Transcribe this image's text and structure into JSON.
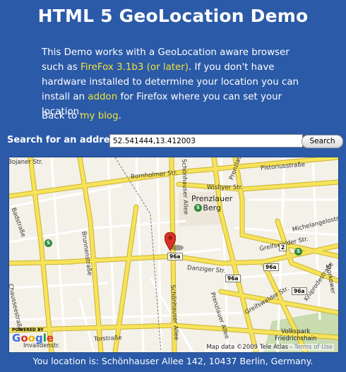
{
  "page": {
    "title": "HTML 5 GeoLocation Demo",
    "intro_part1": "This Demo works with a GeoLocation aware browser such as ",
    "intro_link1": "FireFox 3.1b3 (or later)",
    "intro_part2": ". If you don't have hardware installed to determine your location you can install an ",
    "intro_link2": "addon",
    "intro_part3": " for Firefox where you can set your location.",
    "back_prefix": "Back to ",
    "back_link": "my blog",
    "back_suffix": "."
  },
  "search": {
    "label": "Search for an address:",
    "value": "52.541444,13.412003",
    "button_label": "Search"
  },
  "map": {
    "streets": {
      "bornholmer": "Bornholmer Str.",
      "bojaner": "Bojaner Str.",
      "wisbyer": "Wisbyer Str.",
      "pistorius": "Pistoriusstraße",
      "prenzlauer_promenade": "Prenzlauer Promenade",
      "badstrasse": "Badstraße",
      "schoenhauser_top": "Schönhauser Allee",
      "grellstrasse": "Greifswalder Str.",
      "michelangelo": "Michelangelostraße",
      "brunnenstrasse": "Brunnenstraße",
      "danziger": "Danziger Str.",
      "kniprode": "Kniprodestraße",
      "chaussee": "Chausseestraße",
      "schoenhauser_bottom": "Schönhauser Allee",
      "prenzlauer_allee": "Prenzlauer Allee",
      "storkower": "Storkower",
      "torstrasse": "Torstraße",
      "greifswalder2": "Greifswalder Str.",
      "invalidenstr": "Invalidenstr."
    },
    "districts": {
      "prenzlauer_berg_1": "Prenzlauer",
      "prenzlauer_berg_2": "Berg",
      "volkspark_1": "Volkspark",
      "volkspark_2": "Friedrichshain"
    },
    "badges": {
      "b96a_marker": "96a",
      "b96a_danziger": "96a",
      "b96a_right": "96a",
      "b2": "2",
      "b96a_bottom": "96a"
    },
    "sbahn_label": "S",
    "marker_icon": "map-pin-icon",
    "powered_by": "POWERED BY",
    "google_logo": [
      "G",
      "o",
      "o",
      "g",
      "l",
      "e"
    ],
    "attribution": "Map data ©2009 Tele Atlas -",
    "terms_link": "Terms of Use"
  },
  "location": {
    "text": "You location is: Schönhauser Allee 142, 10437 Berlin, Germany."
  },
  "colors": {
    "background": "#2b5aa8",
    "link": "#f2e337",
    "road_major": "#f7e35a",
    "road_minor": "#ffffff",
    "map_base": "#f4f1e8",
    "park": "#c8dcb0",
    "marker": "#d93025"
  }
}
